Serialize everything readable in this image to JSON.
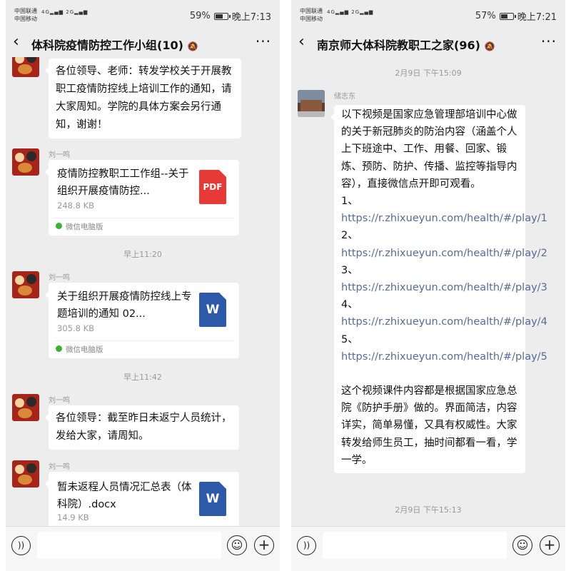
{
  "left": {
    "status": {
      "carrier1": "中国联通",
      "carrier2": "中国移动",
      "net1": "4G",
      "net2": "2G",
      "battery": "59%",
      "time": "晚上7:13"
    },
    "chat_title": "体科院疫情防控工作小组(10)",
    "messages": {
      "m1_text": "各位领导、老师：转发学校关于开展教职工疫情防控线上培训工作的通知，请大家周知。学院的具体方案会另行通知，谢谢！",
      "m2_sender": "刘一鸣",
      "m2_file_name": "疫情防控教职工工作组--关于组织开展疫情防控...",
      "m2_file_size": "248.8 KB",
      "m2_file_type": "PDF",
      "m2_source": "微信电脑版",
      "time1": "早上11:20",
      "m3_sender": "刘一鸣",
      "m3_file_name": "关于组织开展疫情防控线上专题培训的通知 02...",
      "m3_file_size": "305.8 KB",
      "m3_file_type": "W",
      "m3_source": "微信电脑版",
      "time2": "早上11:42",
      "m4_sender": "刘一鸣",
      "m4_text": "各位领导：截至昨日未返宁人员统计，发给大家，请周知。",
      "m5_sender": "刘一鸣",
      "m5_file_name": "暂未返程人员情况汇总表（体科院）.docx",
      "m5_file_size": "14.9 KB",
      "m5_file_type": "W"
    }
  },
  "right": {
    "status": {
      "carrier1": "中国联通",
      "carrier2": "中国移动",
      "net1": "4G",
      "net2": "2G",
      "battery": "57%",
      "time": "晚上7:21"
    },
    "chat_title": "南京师大体科院教职工之家(96)",
    "messages": {
      "time1": "2月9日 下午15:09",
      "sender": "储志东",
      "intro": "以下视频是国家应急管理部培训中心做的关于新冠肺炎的防治内容（涵盖个人上下班途中、工作、用餐、回家、锻炼、预防、防护、传播、监控等指导内容），直接微信点开即可观看。",
      "items": [
        {
          "num": "1、",
          "url": "https://r.zhixueyun.com/health/#/play/1"
        },
        {
          "num": "2、",
          "url": "https://r.zhixueyun.com/health/#/play/2"
        },
        {
          "num": "3、",
          "url": "https://r.zhixueyun.com/health/#/play/3"
        },
        {
          "num": "4、",
          "url": "https://r.zhixueyun.com/health/#/play/4"
        },
        {
          "num": "5、",
          "url": "https://r.zhixueyun.com/health/#/play/5"
        }
      ],
      "outro": "这个视频课件内容都是根据国家应急总院《防护手册》做的。界面简洁，内容详实，简单易懂，又具有权威性。大家转发给师生员工，抽时间都看一看，学一学。",
      "time2": "2月9日 下午15:13"
    }
  },
  "icons": {
    "back": "back-arrow-icon",
    "more": "more-dots-icon",
    "mute": "mute-icon",
    "voice": "voice-icon",
    "emoji": "emoji-icon",
    "plus": "plus-icon"
  },
  "colors": {
    "background": "#ededed",
    "bubble": "#ffffff",
    "link": "#576b95",
    "pdf": "#e63a37",
    "word": "#2c5aa8"
  }
}
